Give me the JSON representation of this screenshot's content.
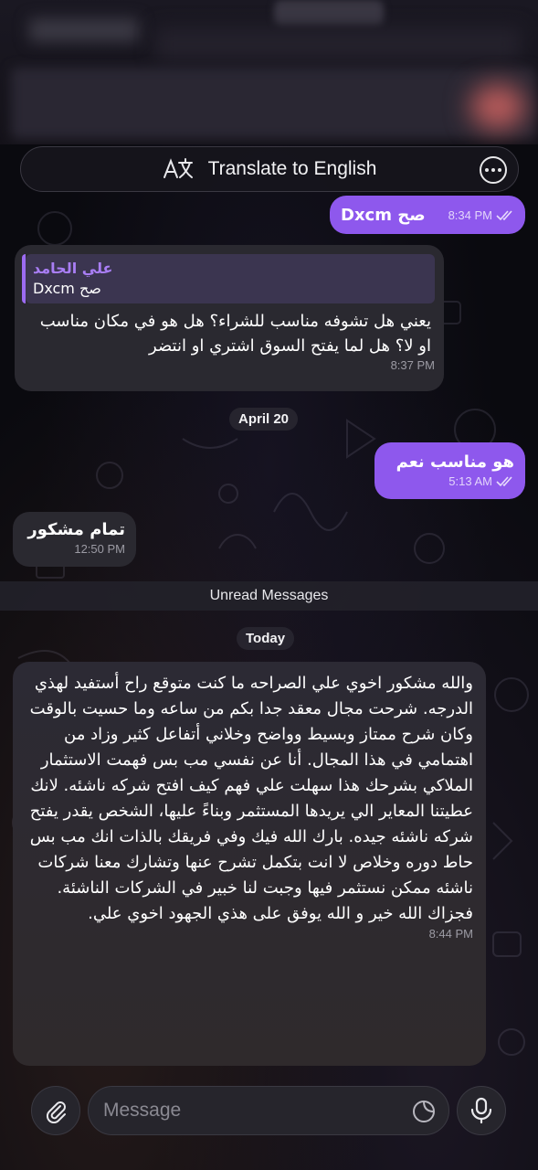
{
  "translate_bar": {
    "label": "Translate to English"
  },
  "messages": [
    {
      "id": "m1",
      "direction": "outgoing",
      "text": "صح Dxcm",
      "time": "8:34 PM",
      "read": true
    },
    {
      "id": "m2",
      "direction": "incoming",
      "reply": {
        "name": "علي الحامد",
        "text": "صح Dxcm"
      },
      "text": "يعني هل تشوفه مناسب للشراء؟ هل هو في مكان مناسب او لا؟ هل لما يفتح السوق اشتري او انتضر",
      "time": "8:37 PM"
    },
    {
      "id": "m3",
      "direction": "outgoing",
      "text": "هو مناسب نعم",
      "time": "5:13 AM",
      "read": true
    },
    {
      "id": "m4",
      "direction": "incoming",
      "text": "تمام مشكور",
      "time": "12:50 PM"
    },
    {
      "id": "m5",
      "direction": "incoming",
      "text": "والله مشكور اخوي علي الصراحه ما كنت متوقع راح أستفيد لهذي الدرجه. شرحت مجال معقد جدا بكم من ساعه وما حسيت بالوقت وكان شرح ممتاز وبسيط وواضح وخلاني أتفاعل كثير وزاد من اهتمامي في هذا المجال. أنا عن نفسي مب بس فهمت الاستثمار الملاكي بشرحك هذا سهلت علي فهم كيف افتح شركه ناشئه. لانك عطيتنا المعاير الي يريدها المستثمر وبناءً عليها، الشخص يقدر يفتح شركه ناشئه جيده. بارك الله فيك وفي فريقك بالذات انك مب بس حاط دوره وخلاص لا انت بتكمل تشرح عنها وتشارك معنا شركات ناشئه ممكن نستثمر فيها وجبت لنا  خبير في الشركات الناشئة. فجزاك الله خير و الله يوفق على هذي الجهود اخوي علي.",
      "time": "8:44 PM"
    }
  ],
  "date_separators": {
    "first": "April 20",
    "second": "Today"
  },
  "unread_label": "Unread Messages",
  "composer": {
    "placeholder": "Message"
  },
  "icons": {
    "translate": "translate-icon",
    "more": "more-options-icon",
    "attach": "paperclip-icon",
    "sticker": "sticker-icon",
    "mic": "microphone-icon",
    "read": "double-check-icon"
  },
  "colors": {
    "outgoing_bubble": "#8e58ed",
    "incoming_bubble": "#2a2930",
    "reply_name": "#a97ef5"
  }
}
